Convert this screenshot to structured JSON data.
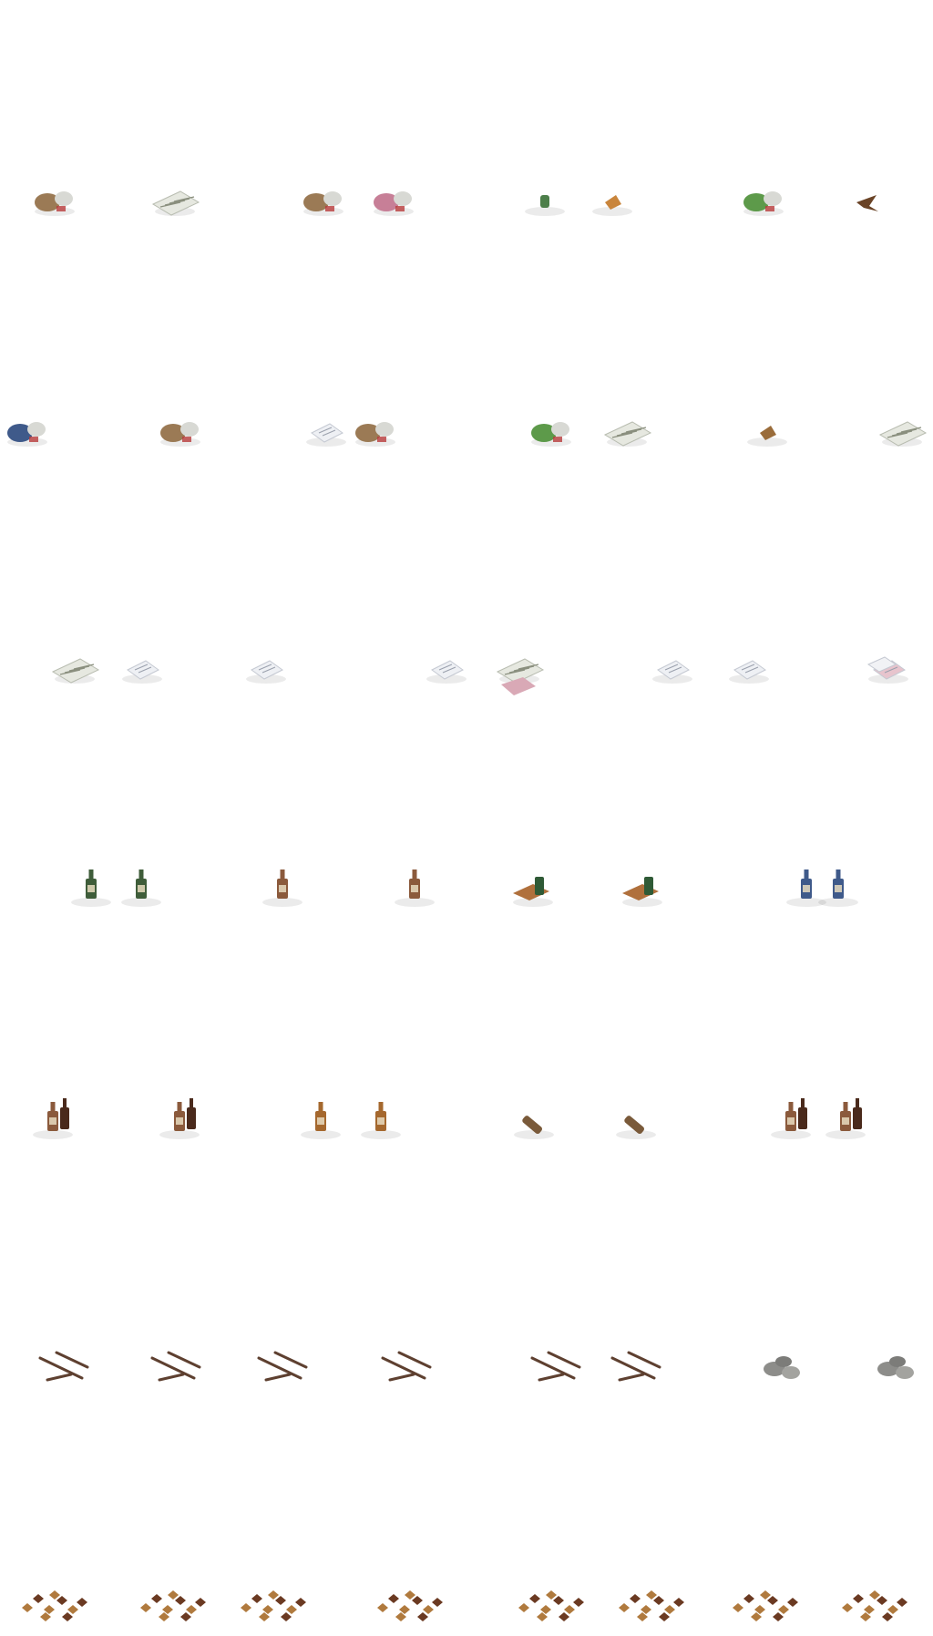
{
  "sheet": {
    "type": "isometric game sprite sheet",
    "background": "#ffffff",
    "rows": [
      {
        "theme": "mixed trash",
        "sprites": [
          "trash-bag-cans",
          "newspaper",
          "rubble-pile",
          "pink-box-trash",
          "small-can",
          "small-wrapper",
          "green-bag-trash",
          "dead-bird"
        ]
      },
      {
        "theme": "garbage heaps",
        "sprites": [
          "blue-trash-bag",
          "trash-heap",
          "paper-cup",
          "bag-pile",
          "green-bag-heap",
          "newspaper-stack",
          "cardboard-scrap",
          "folded-newspaper"
        ]
      },
      {
        "theme": "paper",
        "sprites": [
          "newspaper-stack",
          "paper-sheet",
          "paper-sheet",
          "folded-paper",
          "newspaper-pink",
          "chart-paper",
          "white-paper",
          "pink-papers"
        ]
      },
      {
        "theme": "bottles",
        "sprites": [
          "green-bottle",
          "green-bottle",
          "brown-bottle",
          "brown-bottle",
          "bottle-crate",
          "bottle-crate",
          "blue-bottle",
          "blue-bottle"
        ]
      },
      {
        "theme": "bottle groups",
        "sprites": [
          "bottle-group",
          "bottle-group",
          "amber-bottle",
          "amber-bottle",
          "fallen-bottle",
          "fallen-bottle",
          "brown-bottle-pair",
          "brown-bottle-pair"
        ]
      },
      {
        "theme": "sticks and rocks",
        "sprites": [
          "sticks",
          "sticks",
          "sticks",
          "sticks",
          "sticks",
          "sticks",
          "rocks",
          "rocks"
        ]
      },
      {
        "theme": "fallen leaves",
        "sprites": [
          "leaves",
          "leaves",
          "leaves",
          "leaves",
          "leaves",
          "leaves",
          "leaves",
          "leaves"
        ]
      }
    ]
  },
  "palette": {
    "paper": "#e6e8e0",
    "newspaper_ink": "#8a8f7e",
    "green_bag": "#5d9a4a",
    "pink": "#c77f97",
    "brown": "#8b5a3c",
    "blue": "#3f5a8a",
    "stick": "#5e4030",
    "rock": "#8d8d8a",
    "leaf_dark": "#6b3a22",
    "leaf_light": "#b07a3e"
  }
}
